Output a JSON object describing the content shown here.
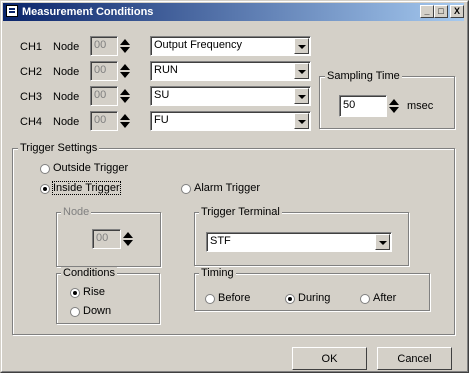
{
  "window": {
    "title": "Measurement Conditions",
    "min_label": "_",
    "max_label": "□",
    "close_label": "X"
  },
  "channels": [
    {
      "label": "CH1",
      "node_label": "Node",
      "node_value": "00",
      "signal": "Output Frequency"
    },
    {
      "label": "CH2",
      "node_label": "Node",
      "node_value": "00",
      "signal": "RUN"
    },
    {
      "label": "CH3",
      "node_label": "Node",
      "node_value": "00",
      "signal": "SU"
    },
    {
      "label": "CH4",
      "node_label": "Node",
      "node_value": "00",
      "signal": "FU"
    }
  ],
  "sampling": {
    "title": "Sampling Time",
    "value": "50",
    "unit": "msec"
  },
  "trigger": {
    "title": "Trigger Settings",
    "outside": "Outside Trigger",
    "inside": "Inside Trigger",
    "alarm": "Alarm Trigger",
    "selected": "inside",
    "node_group": "Node",
    "node_value": "00",
    "terminal_group": "Trigger Terminal",
    "terminal_value": "STF",
    "conditions_group": "Conditions",
    "rise": "Rise",
    "down": "Down",
    "condition_selected": "rise",
    "timing_group": "Timing",
    "before": "Before",
    "during": "During",
    "after": "After",
    "timing_selected": "during"
  },
  "buttons": {
    "ok": "OK",
    "cancel": "Cancel"
  },
  "colors": {
    "titlebar_start": "#0a246a",
    "titlebar_end": "#a6caf0",
    "face": "#d4d0c8"
  }
}
